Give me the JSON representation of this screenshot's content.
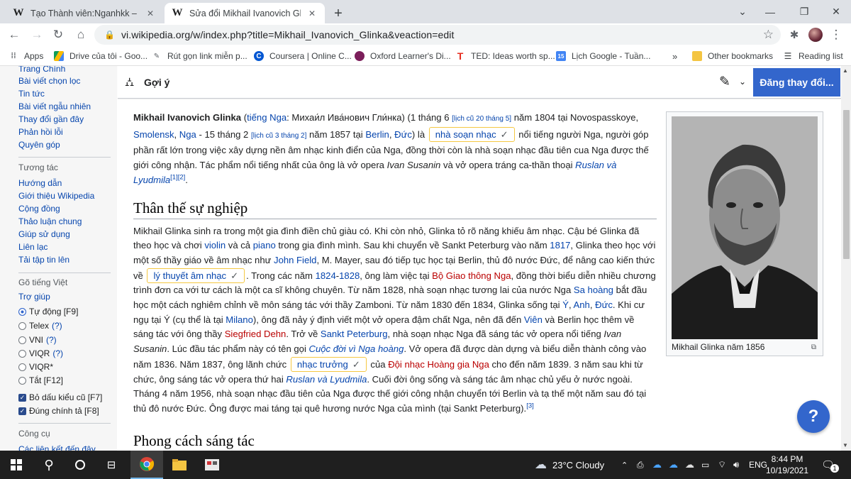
{
  "browser": {
    "tabs": [
      {
        "icon": "W",
        "title": "Tạo Thành viên:Nganhkk – Wikip",
        "active": false
      },
      {
        "icon": "W",
        "title": "Sửa đổi Mikhail Ivanovich Glinka",
        "active": true
      }
    ],
    "url": "vi.wikipedia.org/w/index.php?title=Mikhail_Ivanovich_Glinka&veaction=edit",
    "bookmarks": [
      {
        "label": "Apps",
        "icon": "apps-grid"
      },
      {
        "label": "Drive của tôi - Goo...",
        "icon": "drive"
      },
      {
        "label": "Rút gọn link miễn p...",
        "icon": "link-shortener"
      },
      {
        "label": "Coursera | Online C...",
        "icon": "coursera"
      },
      {
        "label": "Oxford Learner's Di...",
        "icon": "oxford"
      },
      {
        "label": "TED: Ideas worth sp...",
        "icon": "ted"
      },
      {
        "label": "Lịch Google - Tuần...",
        "icon": "calendar"
      },
      {
        "label": "»",
        "icon": "more"
      },
      {
        "label": "Other bookmarks",
        "icon": "folder"
      },
      {
        "label": "Reading list",
        "icon": "reading-list"
      }
    ]
  },
  "sidebar": {
    "top_partial": "Trang Chính",
    "nav": [
      "Bài viết chọn lọc",
      "Tin tức",
      "Bài viết ngẫu nhiên",
      "Thay đổi gần đây",
      "Phản hồi lỗi",
      "Quyên góp"
    ],
    "interact_heading": "Tương tác",
    "interact": [
      "Hướng dẫn",
      "Giới thiệu Wikipedia",
      "Cộng đồng",
      "Thảo luận chung",
      "Giúp sử dụng",
      "Liên lạc",
      "Tải tập tin lên"
    ],
    "typing_heading": "Gõ tiếng Việt",
    "help_link": "Trợ giúp",
    "options": [
      {
        "label": "Tự động [F9]",
        "type": "radio",
        "checked": true,
        "help": ""
      },
      {
        "label": "Telex",
        "type": "radio",
        "checked": false,
        "help": "(?)"
      },
      {
        "label": "VNI",
        "type": "radio",
        "checked": false,
        "help": "(?)"
      },
      {
        "label": "VIQR",
        "type": "radio",
        "checked": false,
        "help": "(?)"
      },
      {
        "label": "VIQR*",
        "type": "radio",
        "checked": false,
        "help": ""
      },
      {
        "label": "Tắt [F12]",
        "type": "radio",
        "checked": false,
        "help": ""
      },
      {
        "label": "Bỏ dấu kiểu cũ [F7]",
        "type": "checkbox",
        "checked": true,
        "help": ""
      },
      {
        "label": "Đúng chính tả [F8]",
        "type": "checkbox",
        "checked": true,
        "help": ""
      }
    ],
    "tools_heading": "Công cụ",
    "tools_partial": "Các liên kết đến đây"
  },
  "editor": {
    "cite_label": "Gợi ý",
    "save_label": "Đăng thay đổi..."
  },
  "article": {
    "intro": {
      "subject": "Mikhail Ivanovich Glinka",
      "lang_link": "tiếng Nga",
      "native": ": Михаи́л Ива́нович Гли́нка) (1 tháng 6 ",
      "os_date1": "[lịch cũ 20 tháng 5]",
      "birth_rest": " năm 1804 tại Novospasskoye,",
      "place1": "Smolensk",
      "place2": "Nga",
      "death": " - 15 tháng 2 ",
      "os_date2": "[lịch cũ 3 tháng 2]",
      "death_rest": " năm 1857 tại ",
      "place3": "Berlin",
      "place4": "Đức",
      "is": ") là ",
      "chip1": "nhà soạn nhạc",
      "after_chip1": " nổi tiếng người Nga, người góp phần rất lớn trong việc xây dựng nền âm nhạc kinh điển của Nga, đồng thời còn là nhà soạn nhạc đầu tiên cua Nga được thế giới công nhận. Tác phẩm nổi tiếng nhất của ông là vở opera ",
      "work1": "Ivan Susanin",
      "mid": " và vở opera tráng ca-thần thoại ",
      "work2": "Ruslan và Lyudmila",
      "ref1": "[1]",
      "ref2": "[2]"
    },
    "section1_title": "Thân thế sự nghiệp",
    "s1": {
      "t1": "Mikhail Glinka sinh ra trong một gia đình điền chủ giàu có. Khi còn nhỏ, Glinka tỏ rõ năng khiếu âm nhạc. Cậu bé Glinka đã theo học và chơi ",
      "violin": "violin",
      "t2": " và cả ",
      "piano": "piano",
      "t3": " trong gia đình mình. Sau khi chuyển về Sankt Peterburg vào năm ",
      "y1817": "1817",
      "t4": ", Glinka theo học với một số thầy giáo về âm nhạc như ",
      "field": "John Field",
      "t5": ", M. Mayer, sau đó tiếp tục học tại Berlin, thủ đô nước Đức, để nâng cao kiến thức về ",
      "chip2": "lý thuyết âm nhạc",
      "t6": ". Trong các năm ",
      "y1824": "1824",
      "dash": "-",
      "y1828": "1828",
      "t7": ", ông làm việc tại ",
      "ministry": "Bộ Giao thông Nga",
      "t8": ", đồng thời biểu diễn nhiều chương trình đơn ca với tư cách là một ca sĩ không chuyên. Từ năm 1828, nhà soạn nhạc tương lai của nước Nga ",
      "tsar": "Sa hoàng",
      "t9": " bắt đầu học một cách nghiêm chỉnh về môn sáng tác với thầy Zamboni. Từ năm 1830 đến 1834, Glinka sống tại ",
      "italy": "Ý",
      "comma": ", ",
      "england": "Anh",
      "france": "Đức",
      "t10": ". Khi cư ngụ tại Ý (cụ thể là tại ",
      "milan": "Milano",
      "t11": "), ông đã nảy ý định viết một vở opera đậm chất Nga, nên đã đến ",
      "vienna": "Viên",
      "t12": " và Berlin học thêm về sáng tác với ông thầy ",
      "dehn": "Siegfried Dehn",
      "t13": ". Trở về ",
      "spb": "Sankt Peterburg",
      "t14": ", nhà soạn nhạc Nga đã sáng tác vở opera nổi tiếng ",
      "susanin": "Ivan Susanin",
      "t15": ". Lúc đầu tác phẩm này có tên gọi ",
      "lifeforczar": "Cuộc đời vì Nga hoàng",
      "t16": ". Vở opera đã được dàn dựng và biểu diễn thành công vào năm 1836. Năm 1837, ông lãnh chức ",
      "chip3": "nhạc trưởng",
      "t17": " của ",
      "choir": "Đội nhạc Hoàng gia Nga",
      "t18": " cho đến năm 1839. 3 năm sau khi từ chức, ông sáng tác vở opera thứ hai ",
      "ruslan": "Ruslan và Lyudmila",
      "t19": ". Cuối đời ông sống và sáng tác âm nhạc chủ yếu ở nước ngoài. Tháng 4 năm 1956, nhà soạn nhạc đầu tiên của Nga được thế giới công nhận chuyển tới Berlin và tạ thế một năm sau đó tại thủ đô nước Đức. Ông được mai táng tại quê hương nước Nga của mình (tại Sankt Peterburg).",
      "ref3": "[3]"
    },
    "section2_title": "Phong cách sáng tác"
  },
  "infobox": {
    "caption": "Mikhail Glinka năm 1856"
  },
  "taskbar": {
    "weather": "23°C  Cloudy",
    "lang": "ENG",
    "time": "8:44 PM",
    "date": "10/19/2021",
    "notif_count": "1"
  }
}
